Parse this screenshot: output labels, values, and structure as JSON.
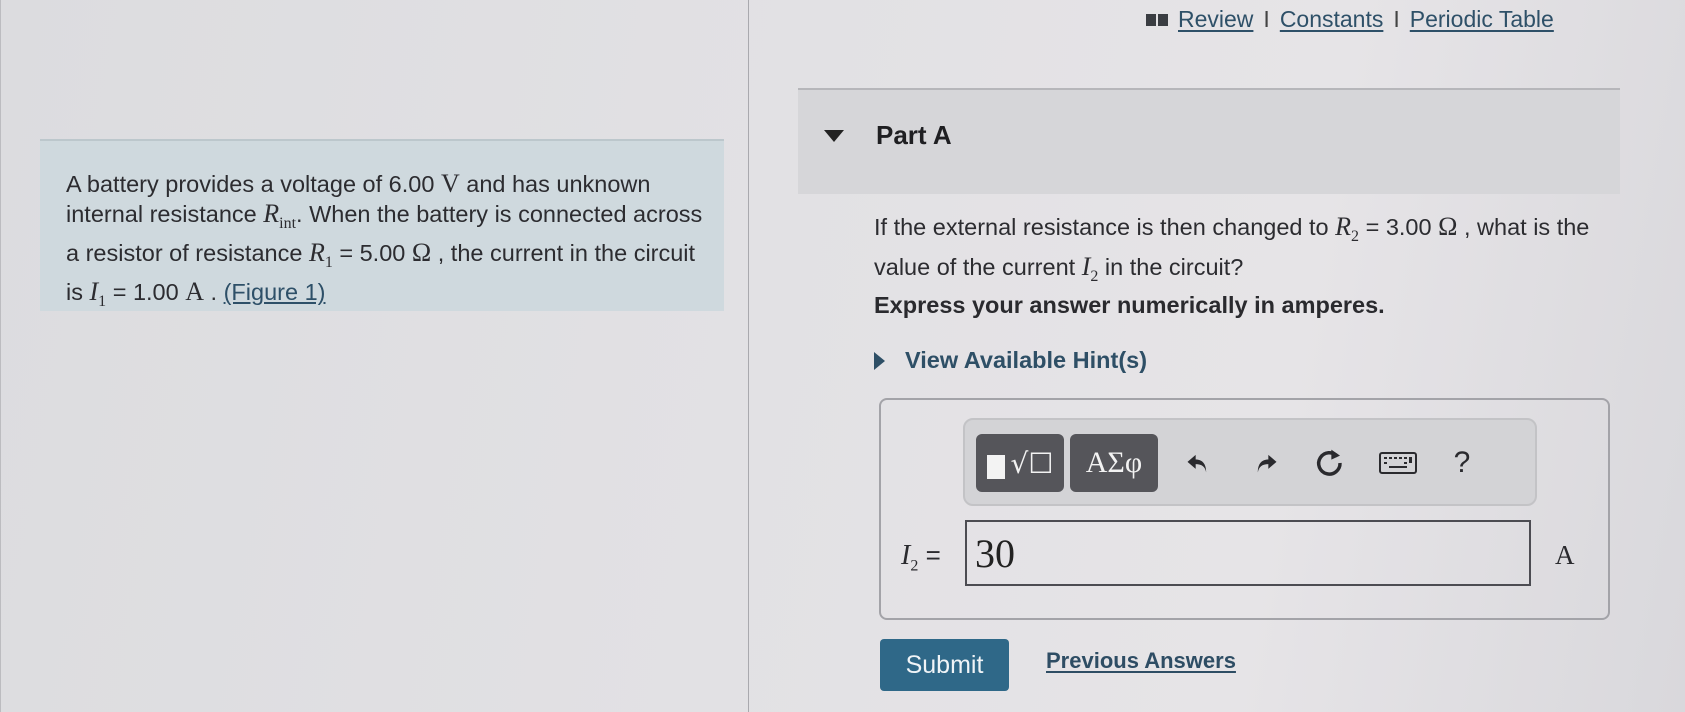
{
  "top_links": {
    "icon": "book-icon",
    "items": [
      "Review",
      "Constants",
      "Periodic Table"
    ],
    "separator": "I"
  },
  "problem": {
    "segments": {
      "s1": "A battery provides a voltage of 6.00 ",
      "u1": "V",
      "s2": " and has unknown internal resistance ",
      "v1": "R",
      "v1_sub": "int",
      "s3": ". When the battery is connected across a resistor of resistance ",
      "v2": "R",
      "v2_sub": "1",
      "s4": " = 5.00 ",
      "u2": "Ω",
      "s5": " , the current in the circuit is ",
      "v3": "I",
      "v3_sub": "1",
      "s6": " = 1.00 ",
      "u3": "A",
      "s7": " . ",
      "figure_link": "(Figure 1)"
    }
  },
  "part": {
    "title": "Part A",
    "expanded": true
  },
  "question": {
    "s1": "If the external resistance is then changed to ",
    "v1": "R",
    "v1_sub": "2",
    "s2": " = 3.00 ",
    "u1": "Ω",
    "s3": " , what is the value of the current ",
    "v2": "I",
    "v2_sub": "2",
    "s4": " in the circuit?"
  },
  "instruction": "Express your answer numerically in amperes.",
  "hint_label": "View Available Hint(s)",
  "toolbar": {
    "templates_icon": "√☐",
    "greek_label": "ΑΣφ",
    "undo": "undo-icon",
    "redo": "redo-icon",
    "reset": "reset-icon",
    "keyboard": "keyboard-icon",
    "help_label": "?"
  },
  "answer": {
    "variable": "I",
    "variable_sub": "2",
    "equals": "=",
    "value": "30",
    "unit": "A"
  },
  "actions": {
    "submit_label": "Submit",
    "previous_answers_label": "Previous Answers"
  },
  "colors": {
    "accent": "#2f6888",
    "link": "#2e5068",
    "problem_bg": "#cfd9de"
  }
}
